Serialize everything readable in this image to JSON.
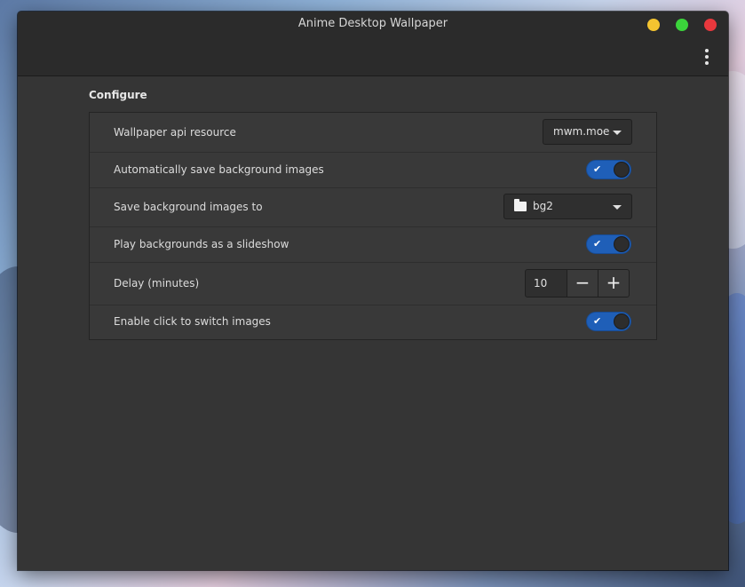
{
  "window": {
    "title": "Anime Desktop Wallpaper"
  },
  "titlebar_buttons": {
    "minimize_color": "#f4c430",
    "maximize_color": "#3bd43b",
    "close_color": "#e8383d",
    "menu_icon": "vertical-ellipsis-icon"
  },
  "configure": {
    "section_title": "Configure",
    "rows": [
      {
        "label": "Wallpaper api resource",
        "control": "dropdown",
        "value": "mwm.moe"
      },
      {
        "label": "Automatically save background images",
        "control": "toggle",
        "checked": true
      },
      {
        "label": "Save background images to",
        "control": "folder-chooser",
        "value": "bg2",
        "icon": "folder-icon"
      },
      {
        "label": "Play backgrounds as a slideshow",
        "control": "toggle",
        "checked": true
      },
      {
        "label": "Delay (minutes)",
        "control": "spinbutton",
        "value": "10"
      },
      {
        "label": "Enable click to switch images",
        "control": "toggle",
        "checked": true
      }
    ]
  },
  "colors": {
    "window_bg": "#353535",
    "titlebar_bg": "#2b2b2b",
    "toggle_accent": "#1f5fb8"
  }
}
